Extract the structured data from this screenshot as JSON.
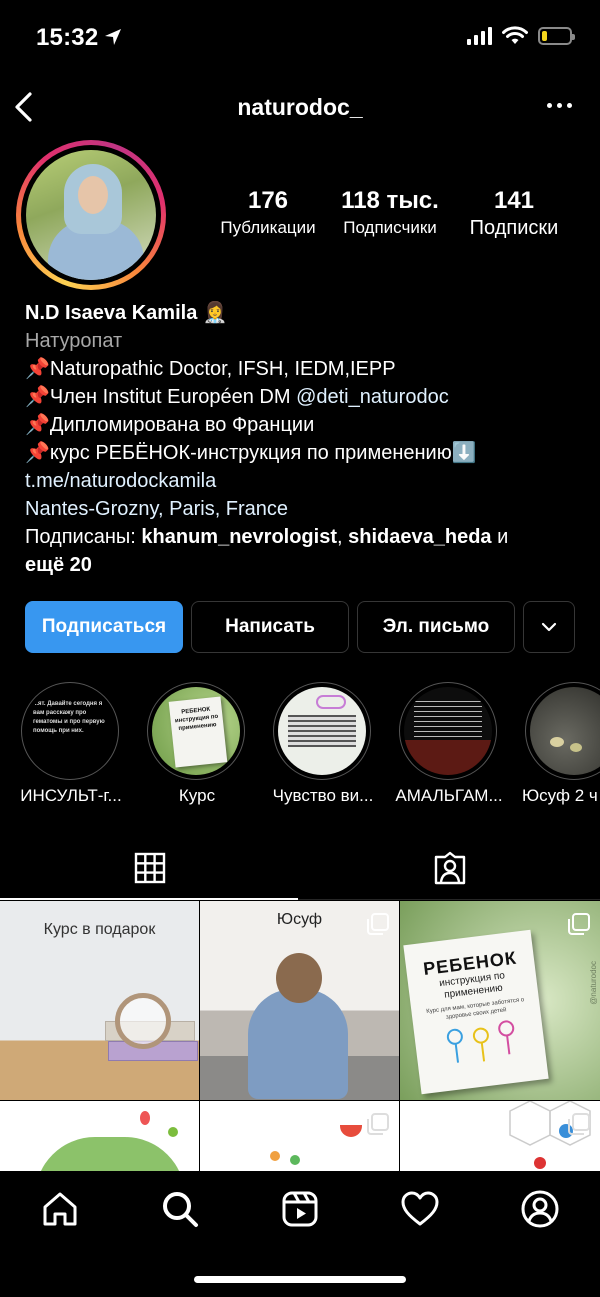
{
  "status_bar": {
    "time": "15:32",
    "battery_level": 0.2,
    "battery_color": "#f5d61d"
  },
  "header": {
    "username": "naturodoc_"
  },
  "profile": {
    "stats": [
      {
        "value": "176",
        "label": "Публикации"
      },
      {
        "value": "118 тыс.",
        "label": "Подписчики"
      },
      {
        "value": "141",
        "label": "Подписки"
      }
    ],
    "name": "N.D Isaeva Kamila 👩‍⚕️",
    "category": "Натуропат",
    "bio_lines": [
      "📌Naturopathic Doctor, IFSH, IEDM,IEPP",
      "📌Член Institut Européen DM ",
      "📌Дипломирована во Франции",
      "📌курс РЕБЁНОК-инструкция по применению⬇️"
    ],
    "bio_mention": "@deti_naturodoc",
    "link": "t.me/naturodockamila",
    "location": "Nantes-Grozny, Paris, France",
    "followed_by_prefix": "Подписаны: ",
    "followed_by_user1": "khanum_nevrologist",
    "followed_by_sep": ", ",
    "followed_by_user2": "shidaeva_heda",
    "followed_by_and": " и",
    "followed_by_more": "ещё 20"
  },
  "buttons": {
    "follow": "Подписаться",
    "message": "Написать",
    "email": "Эл. письмо"
  },
  "highlights": [
    {
      "label": "ИНСУЛЬТ-г...",
      "text": "...ят. Давайте сегодня я вам расскажу про гематомы и про первую помощь при них."
    },
    {
      "label": "Курс",
      "text": "РЕБЕНОК инструкция по применению"
    },
    {
      "label": "Чувство ви...",
      "text": ""
    },
    {
      "label": "АМАЛЬГАМ...",
      "text": ""
    },
    {
      "label": "Юсуф 2 ч",
      "text": ""
    }
  ],
  "posts": [
    {
      "caption": "Курс в подарок"
    },
    {
      "caption": "Юсуф"
    },
    {
      "caption": "РЕБЕНОК",
      "subtitle": "инструкция по применению",
      "small": "Курс для мам, которые заботятся о здоровье своих детей",
      "watermark": "@naturodoc"
    }
  ],
  "colors": {
    "primary_button": "#3897f0",
    "link": "#e0f1ff",
    "secondary_text": "#a8a8a8"
  }
}
